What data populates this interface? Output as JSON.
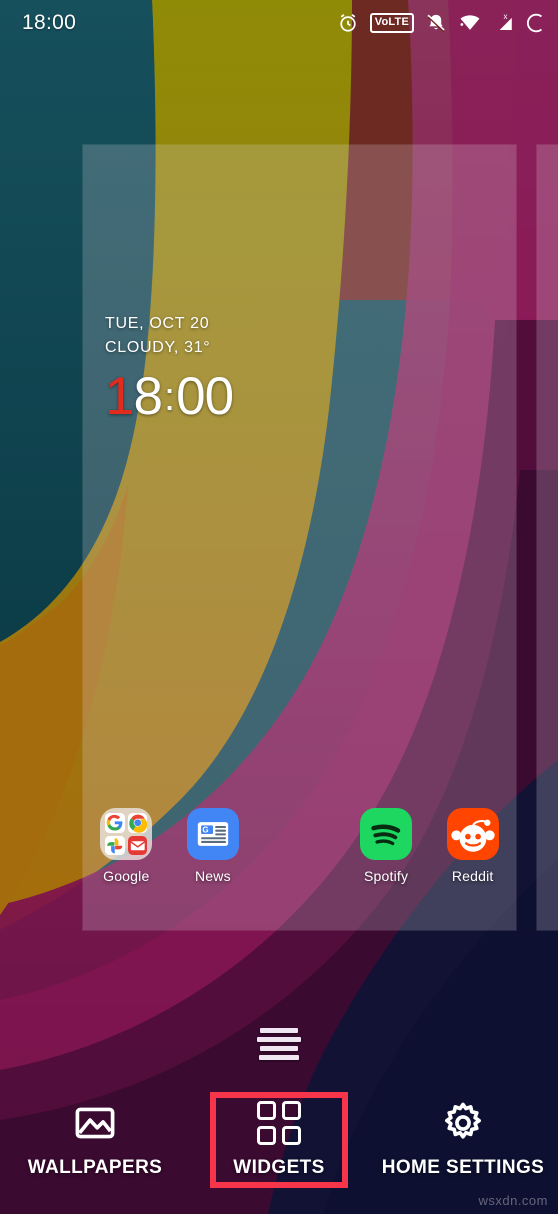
{
  "status_bar": {
    "clock": "18:00",
    "icons": [
      {
        "name": "alarm-icon",
        "label": "alarm"
      },
      {
        "name": "volte-icon",
        "label": "VoLTE"
      },
      {
        "name": "mute-icon",
        "label": "ringer muted"
      },
      {
        "name": "wifi-icon",
        "label": "wi-fi"
      },
      {
        "name": "cellular-signal-icon",
        "label": "no mobile data"
      },
      {
        "name": "battery-icon",
        "label": "battery"
      }
    ],
    "volte_text": "VoLTE"
  },
  "clock_widget": {
    "date": "TUE, OCT 20",
    "weather": "CLOUDY, 31°",
    "time_first_digit": "1",
    "time_second_digit": "8",
    "time_separator": ":",
    "time_minutes": "00",
    "accent_color": "#e02b1e"
  },
  "dock": {
    "items": [
      {
        "label": "Google",
        "icon": "google-folder-icon",
        "type": "folder"
      },
      {
        "label": "News",
        "icon": "google-news-icon",
        "type": "app"
      },
      {
        "label": "",
        "icon": "empty-slot",
        "type": "empty"
      },
      {
        "label": "Spotify",
        "icon": "spotify-icon",
        "type": "app"
      },
      {
        "label": "Reddit",
        "icon": "reddit-icon",
        "type": "app"
      }
    ],
    "folder_apps": [
      "google-search-icon",
      "chrome-icon",
      "google-photos-icon",
      "gmail-icon"
    ]
  },
  "page_indicator": {
    "name": "home-screen-page-indicator",
    "bars": 4
  },
  "action_bar": {
    "items": [
      {
        "label": "WALLPAPERS",
        "icon": "wallpaper-image-icon",
        "selected": false
      },
      {
        "label": "WIDGETS",
        "icon": "widgets-grid-icon",
        "selected": true
      },
      {
        "label": "HOME SETTINGS",
        "icon": "gear-icon",
        "selected": false
      }
    ],
    "highlight_color": "#f6344a"
  },
  "watermark": {
    "text": "wsxdn.com"
  },
  "wallpaper": {
    "colors": {
      "teal": "#0f4954",
      "olive": "#8f8b07",
      "amber": "#a56c0d",
      "brick": "#6d2a23",
      "magenta": "#8b1356",
      "plum": "#5d1043",
      "navy": "#111234",
      "deep_purple": "#2d0b2c"
    }
  }
}
